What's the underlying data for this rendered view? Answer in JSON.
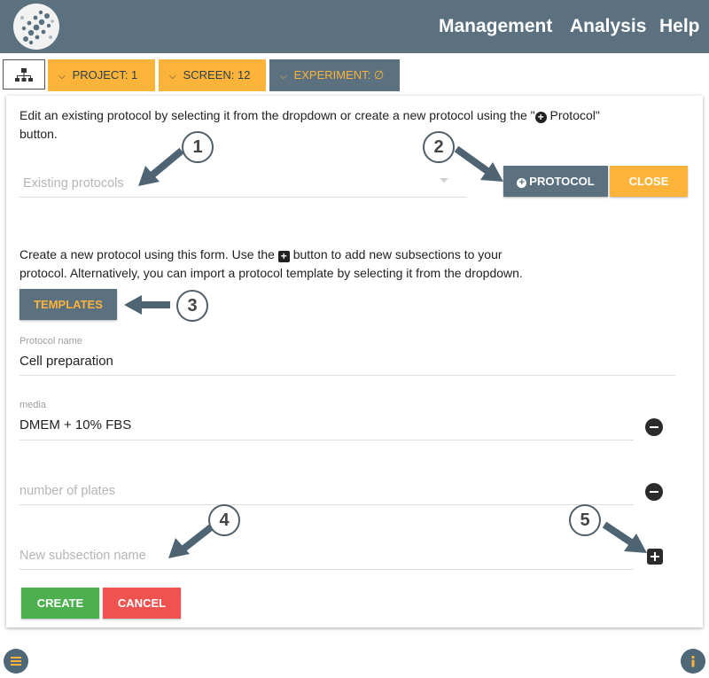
{
  "nav": {
    "links": [
      "Management",
      "Analysis",
      "Help"
    ]
  },
  "breadcrumbs": {
    "project": "PROJECT: 1",
    "screen": "SCREEN: 12",
    "experiment": "EXPERIMENT: ∅"
  },
  "existing": {
    "instructions": "Edit an existing protocol by selecting it from the dropdown or create a new protocol using the \"",
    "instructions_btn": " Protocol\"",
    "instructions_end": "button.",
    "dropdown_placeholder": "Existing protocols",
    "protocol_button": "PROTOCOL",
    "close_button": "CLOSE"
  },
  "form": {
    "instructions_1": "Create a new protocol using this form. Use the",
    "instructions_2": "button to add new subsections to your",
    "instructions_3": "protocol. Alternatively, you can import a protocol template by selecting it from the dropdown.",
    "templates_button": "TEMPLATES",
    "protocol_name_label": "Protocol name",
    "protocol_name_value": "Cell preparation",
    "media_label": "media",
    "media_value": "DMEM + 10% FBS",
    "plates_placeholder": "number of plates",
    "subsection_placeholder": "New subsection name",
    "create_button": "CREATE",
    "cancel_button": "CANCEL"
  },
  "callouts": [
    "1",
    "2",
    "3",
    "4",
    "5"
  ],
  "colors": {
    "navbar": "#5b7180",
    "accent_orange": "#fbb33a",
    "create_green": "#4cb04f",
    "cancel_red": "#ef5350"
  }
}
